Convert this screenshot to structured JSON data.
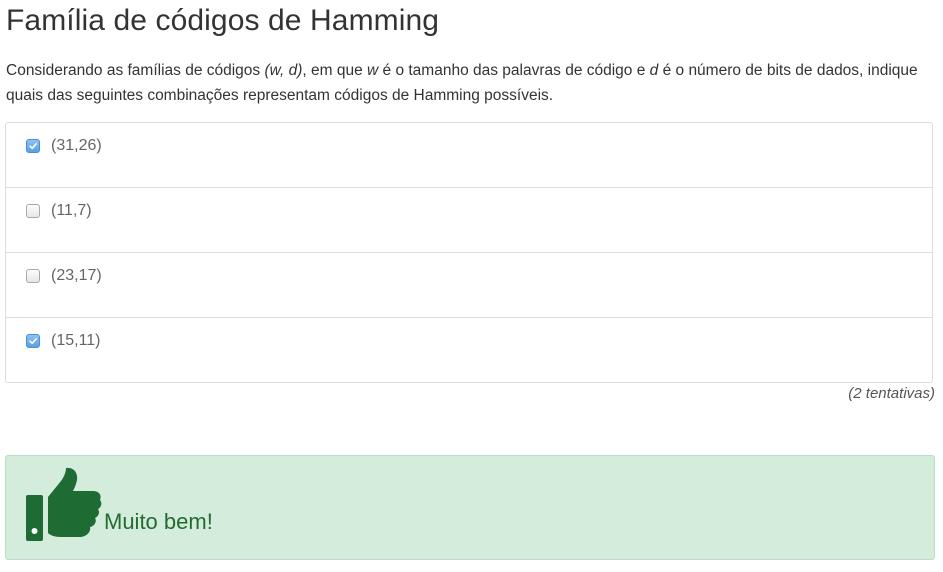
{
  "title": "Família de códigos de Hamming",
  "intro": {
    "part1": "Considerando as famílias de códigos ",
    "pair": "(w, d)",
    "part2": ", em que ",
    "w": "w",
    "part3": " é o tamanho das palavras de código e ",
    "d": "d",
    "part4": " é o número de bits de dados, indique quais das seguintes combinações representam códigos de Hamming possíveis."
  },
  "options": [
    {
      "label": "(31,26)",
      "checked": true
    },
    {
      "label": "(11,7)",
      "checked": false
    },
    {
      "label": "(23,17)",
      "checked": false
    },
    {
      "label": "(15,11)",
      "checked": true
    }
  ],
  "attempts": "(2 tentativas)",
  "feedback": {
    "text": "Muito bem!",
    "icon": "thumbs-up-icon",
    "color": "#236b33",
    "background": "#d3ecdc"
  }
}
